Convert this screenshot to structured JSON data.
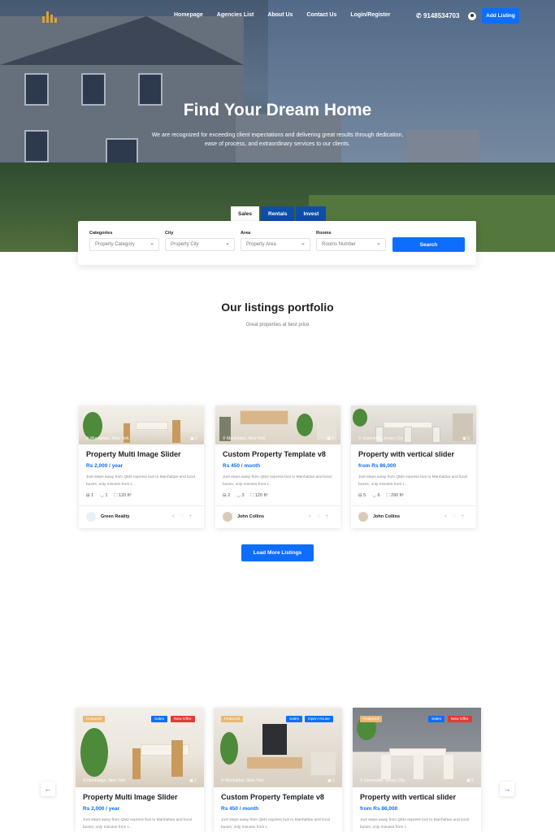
{
  "nav": {
    "links": [
      "Homepage",
      "Agencies List",
      "About Us",
      "Contact Us",
      "Login/Register"
    ],
    "phone": "9148534703",
    "add_listing": "Add Listing"
  },
  "hero": {
    "title": "Find Your Dream Home",
    "subtitle": "We are recognized for exceeding client expectations and delivering great results through dedication, ease of process, and extraordinary services to our clients."
  },
  "search": {
    "tabs": [
      "Sales",
      "Rentals",
      "Invest"
    ],
    "active_tab": "Sales",
    "fields": [
      {
        "label": "Categories",
        "value": "Property Category"
      },
      {
        "label": "City",
        "value": "Property City"
      },
      {
        "label": "Area",
        "value": "Property Area"
      },
      {
        "label": "Rooms",
        "value": "Rooms Number"
      }
    ],
    "button": "Search"
  },
  "portfolio": {
    "title": "Our listings portfolio",
    "subtitle": "Great properties at best price",
    "load_more": "Load More Listings"
  },
  "listings": [
    {
      "location": "Manhattan, New York",
      "photos": "2",
      "title": "Property Multi Image Slider",
      "price": "Rs 2,000 / year",
      "desc": "Just steps away from QM2 express bus to Manhattan and local buses; only minutes from t...",
      "beds": "1",
      "baths": "1",
      "size": "120 ft²",
      "agent": "Green Reality"
    },
    {
      "location": "Manhattan, New York",
      "photos": "1",
      "title": "Custom Property Template v8",
      "price": "Rs 450 / month",
      "desc": "Just steps away from QM2 express bus to Manhattan and local buses; only minutes from t...",
      "beds": "2",
      "baths": "3",
      "size": "120 ft²",
      "agent": "John Collins"
    },
    {
      "location": "Greenville, Jersey City",
      "photos": "5",
      "title": "Property with vertical slider",
      "price": "from Rs 86,000",
      "desc": "Just steps away from QM2 express bus to Manhattan and local buses; only minutes from t...",
      "beds": "5",
      "baths": "6",
      "size": "290 ft²",
      "agent": "John Collins"
    }
  ],
  "featured": [
    {
      "badges": [
        "Featured",
        "Sales",
        "New Offer"
      ],
      "location": "Manhattan, New York",
      "photos": "2",
      "title": "Property Multi Image Slider",
      "price": "Rs 2,000 / year",
      "desc": "Just steps away from QM2 express bus to Manhattan and local buses; only minutes from t..."
    },
    {
      "badges": [
        "Featured",
        "Sales",
        "Open House"
      ],
      "location": "Manhattan, New York",
      "photos": "1",
      "title": "Custom Property Template v8",
      "price": "Rs 450 / month",
      "desc": "Just steps away from QM2 express bus to Manhattan and local buses; only minutes from t..."
    },
    {
      "badges": [
        "Featured",
        "Sales",
        "New Offer"
      ],
      "location": "Greenville, Jersey City",
      "photos": "5",
      "title": "Property with vertical slider",
      "price": "from Rs 86,000",
      "desc": "Just steps away from QM2 express bus to Manhattan and local buses; only minutes from t..."
    }
  ],
  "colors": {
    "accent": "#0d6efd",
    "tab_dark": "#0e4ea8",
    "badge_featured": "#e9b872",
    "badge_sales": "#0d6efd",
    "badge_offer": "#e53935"
  },
  "icons": [
    "logo-icon",
    "phone-icon",
    "user-icon",
    "location-pin-icon",
    "camera-icon",
    "bed-icon",
    "bath-icon",
    "area-icon",
    "share-icon",
    "heart-icon",
    "plus-icon",
    "arrow-left-icon",
    "arrow-right-icon"
  ]
}
